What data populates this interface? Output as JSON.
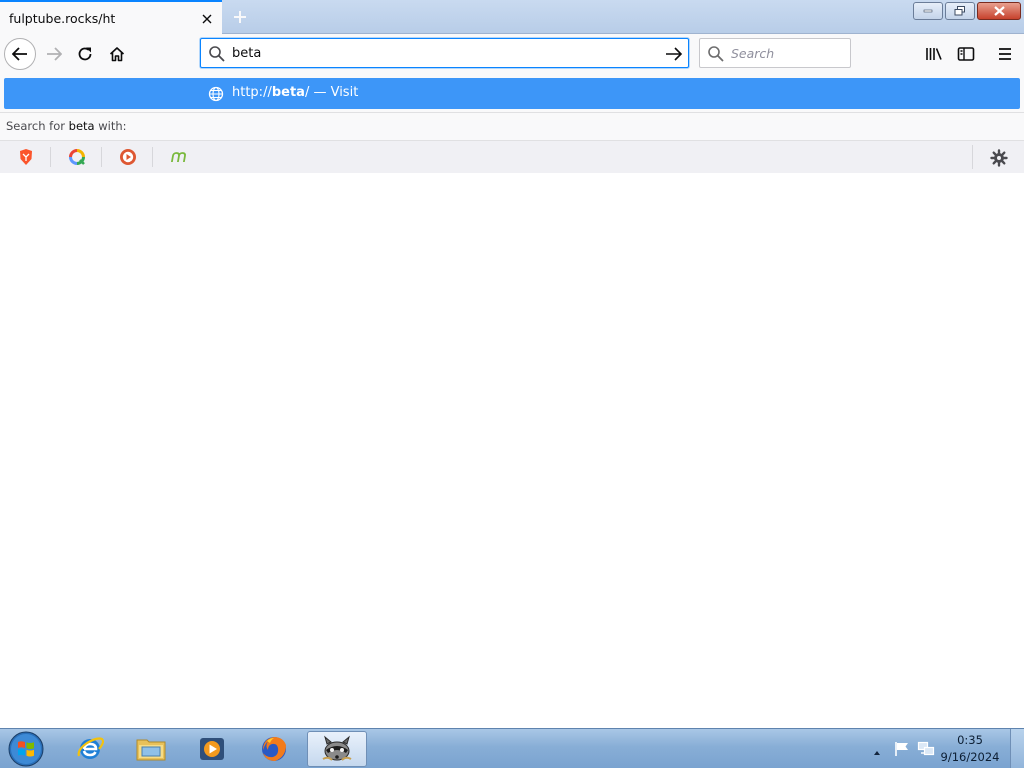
{
  "tab": {
    "title": "fulptube.rocks/ht"
  },
  "urlbar": {
    "value": "beta"
  },
  "searchbar": {
    "placeholder": "Search"
  },
  "suggestion": {
    "prefix": "http://",
    "bold": "beta",
    "suffix": "/",
    "action": " — Visit"
  },
  "search_with": {
    "prefix": "Search for ",
    "term": "beta",
    "suffix": " with:"
  },
  "engines": [
    {
      "name": "brave-search-icon",
      "color": "#fb542b"
    },
    {
      "name": "qwant-icon",
      "color": "#5c97ff"
    },
    {
      "name": "duckduckgo-icon",
      "color": "#de5833"
    },
    {
      "name": "mojeek-icon",
      "color": "#7ab93d"
    }
  ],
  "taskbar": {
    "apps": [
      "internet-explorer-icon",
      "windows-explorer-icon",
      "windows-media-player-icon",
      "firefox-icon",
      "raccoon-app-icon"
    ]
  },
  "clock": {
    "time": "0:35",
    "date": "9/16/2024"
  },
  "colors": {
    "accent": "#0a84ff",
    "suggestion_bg": "#3d96f8"
  }
}
